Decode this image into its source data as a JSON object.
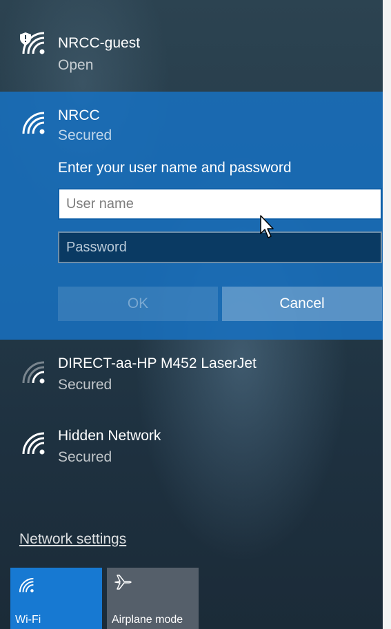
{
  "networks": [
    {
      "name": "NRCC-guest",
      "status": "Open",
      "icon": "wifi-shield-icon"
    },
    {
      "name": "NRCC",
      "status": "Secured",
      "icon": "wifi-icon"
    },
    {
      "name": "DIRECT-aa-HP M452 LaserJet",
      "status": "Secured",
      "icon": "wifi-weak-icon"
    },
    {
      "name": "Hidden Network",
      "status": "Secured",
      "icon": "wifi-icon"
    }
  ],
  "login": {
    "prompt": "Enter your user name and password",
    "username_placeholder": "User name",
    "password_placeholder": "Password",
    "ok_label": "OK",
    "cancel_label": "Cancel"
  },
  "footer": {
    "settings_link": "Network settings",
    "tiles": [
      {
        "label": "Wi-Fi",
        "icon": "wifi-icon",
        "active": true
      },
      {
        "label": "Airplane mode",
        "icon": "airplane-icon",
        "active": false
      }
    ]
  },
  "colors": {
    "accent": "#1779d2",
    "expanded_bg": "#1870be",
    "panel_bg": "#243a48"
  }
}
